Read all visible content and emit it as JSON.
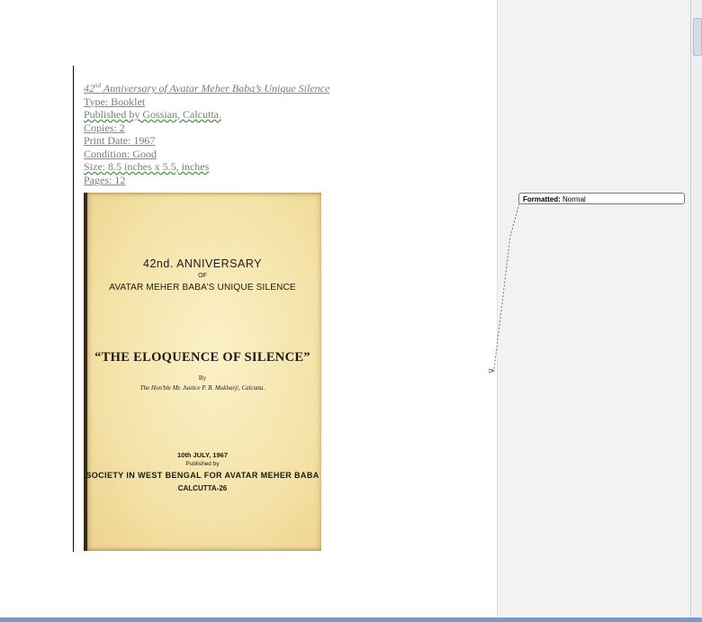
{
  "document": {
    "title_prefix": "42",
    "title_superscript": "nd",
    "title_rest": " Anniversary of Avatar Meher Baba’s Unique Silence",
    "type": "Type: Booklet",
    "published_by": "Published by Gossian, Calcutta.",
    "copies": "Copies: 2",
    "print_date": "Print Date: 1967",
    "condition": "Condition: Good",
    "size": "Size: 8.5 inches x 5.5, inches",
    "pages": "Pages: 12"
  },
  "cover": {
    "line1": "42nd. ANNIVERSARY",
    "line2": "OF",
    "line3": "AVATAR MEHER BABA’S UNIQUE SILENCE",
    "headline": "“THE ELOQUENCE OF SILENCE”",
    "by": "By",
    "author": "The Hon'ble Mr. Justice P. B. Mukharji, Calcutta.",
    "date": "10th JULY, 1967",
    "published_by": "Published by",
    "society": "SOCIETY IN WEST BENGAL FOR AVATAR MEHER BABA",
    "city": "CALCUTTA-26"
  },
  "comment_balloon": {
    "label": "Formatted:",
    "value": "Normal"
  },
  "colors": {
    "tracked_text": "#7a7a7a",
    "margin_bg": "#f2f2f2",
    "bottom_bar": "#7d99c0"
  }
}
